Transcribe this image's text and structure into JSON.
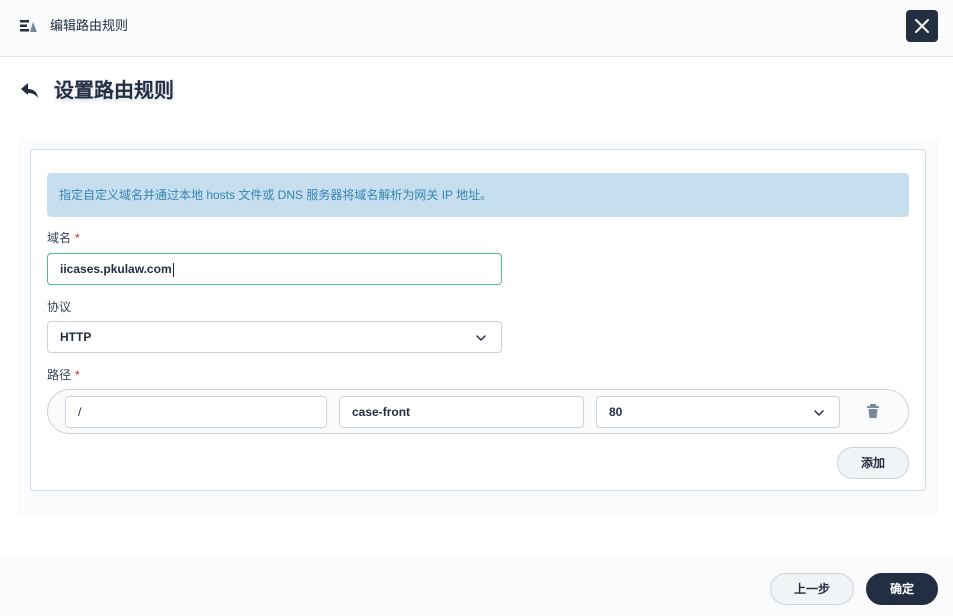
{
  "titlebar": {
    "title": "编辑路由规则",
    "app_icon": "route-rules-icon",
    "close_icon": "close-icon"
  },
  "header": {
    "back_icon": "back-arrow-icon",
    "title": "设置路由规则"
  },
  "banner": {
    "text": "指定自定义域名并通过本地 hosts 文件或 DNS 服务器将域名解析为网关 IP 地址。"
  },
  "form": {
    "domain": {
      "label": "域名",
      "required_mark": "*",
      "value": "iicases.pkulaw.com"
    },
    "protocol": {
      "label": "协议",
      "selected": "HTTP"
    },
    "paths": {
      "label": "路径",
      "required_mark": "*",
      "rows": [
        {
          "path": "/",
          "service": "case-front",
          "port": "80"
        }
      ]
    },
    "add_label": "添加"
  },
  "footer": {
    "prev_label": "上一步",
    "confirm_label": "确定"
  },
  "colors": {
    "primary": "#242e42",
    "banner_bg": "#c7deef",
    "banner_text": "#3385b0",
    "focus_border": "#55bc8a",
    "required": "#ca2621"
  }
}
